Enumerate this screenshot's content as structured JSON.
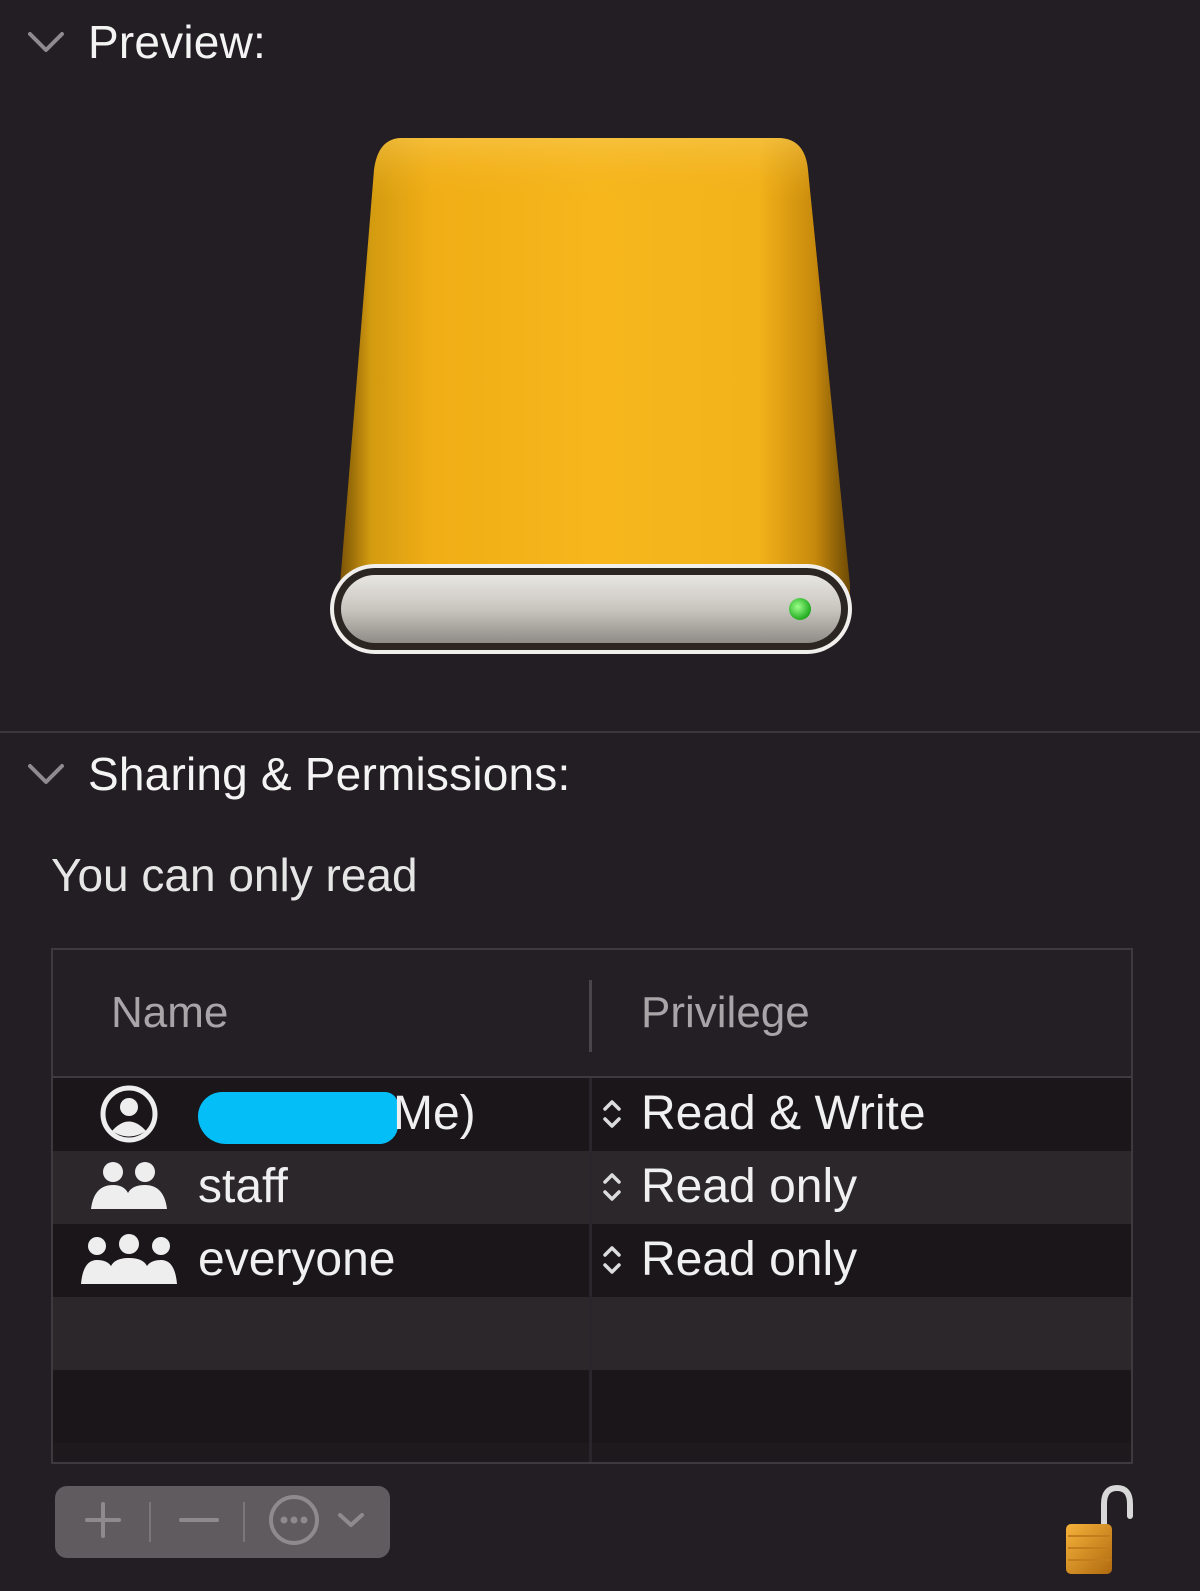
{
  "sections": {
    "preview": {
      "title": "Preview:"
    },
    "permissions": {
      "title": "Sharing & Permissions:"
    }
  },
  "permissions": {
    "status": "You can only read",
    "columns": {
      "name": "Name",
      "privilege": "Privilege"
    },
    "rows": [
      {
        "name": "Me)",
        "privilege": "Read & Write",
        "icon": "user-icon",
        "redacted": true
      },
      {
        "name": "staff",
        "privilege": "Read only",
        "icon": "group-icon"
      },
      {
        "name": "everyone",
        "privilege": "Read only",
        "icon": "everyone-icon"
      }
    ]
  },
  "toolbar": {
    "add": "add-icon",
    "remove": "remove-icon",
    "actions": "ellipsis-circle-icon"
  },
  "colors": {
    "drive_body": "#f2b21a",
    "drive_led": "#2fd02f",
    "redaction": "#04bef8",
    "background": "#231e23"
  }
}
